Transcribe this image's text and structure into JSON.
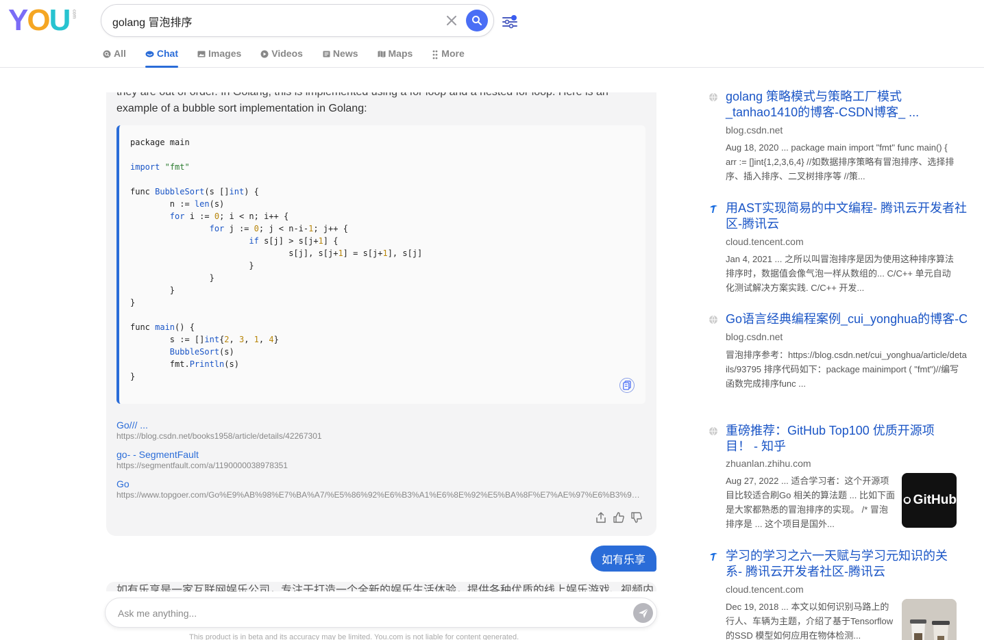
{
  "logo": {
    "text": "YOU",
    "sub": "com"
  },
  "search": {
    "query": "golang 冒泡排序",
    "placeholder": ""
  },
  "tabs": [
    {
      "label": "All",
      "icon": "search-icon"
    },
    {
      "label": "Chat",
      "icon": "chat-icon",
      "active": true
    },
    {
      "label": "Images",
      "icon": "image-icon"
    },
    {
      "label": "Videos",
      "icon": "play-icon"
    },
    {
      "label": "News",
      "icon": "newspaper-icon"
    },
    {
      "label": "Maps",
      "icon": "map-icon"
    },
    {
      "label": "More",
      "icon": "more-icon"
    }
  ],
  "chat": {
    "intro_cut": "they are out of order. In Golang, this is implemented using a for loop and a nested for loop. Here is an",
    "intro": "example of a bubble sort implementation in Golang:",
    "references": [
      {
        "title": "Go/// ...",
        "url": "https://blog.csdn.net/books1958/article/details/42267301"
      },
      {
        "title": "go- - SegmentFault",
        "url": "https://segmentfault.com/a/1190000038978351"
      },
      {
        "title": "Go",
        "url": "https://www.topgoer.com/Go%E9%AB%98%E7%BA%A7/%E5%86%92%E6%B3%A1%E6%8E%92%E5%BA%8F%E7%AE%97%E6%B3%95...."
      }
    ],
    "user_message": "如有乐享",
    "next_reply_cut": "如有乐享是一家互联网娱乐公司，专注于打造一个全新的娱乐生活体验，提供各种优质的线上娱乐游戏、视频内",
    "ask_placeholder": "Ask me anything...",
    "disclaimer": "This product is in beta and its accuracy may be limited. You.com is not liable for content generated."
  },
  "results": [
    {
      "title": "golang 策略模式与策略工厂模式_tanhao1410的博客-CSDN博客_ ...",
      "domain": "blog.csdn.net",
      "snippet": "Aug 18, 2020 ... package main import \"fmt\" func main() { arr := []int{1,2,3,6,4} //如数据排序策略有冒泡排序、选择排序、插入排序、二叉树排序等 //策...",
      "icon": "globe-icon"
    },
    {
      "title": "用AST实现简易的中文编程- 腾讯云开发者社区-腾讯云",
      "domain": "cloud.tencent.com",
      "snippet": "Jan 4, 2021 ... 之所以叫冒泡排序是因为使用这种排序算法排序时，数据值会像气泡一样从数组的... C/C++ 单元自动化测试解决方案实践. C/C++ 开发...",
      "icon": "tencent-icon"
    },
    {
      "title": "Go语言经典编程案例_cui_yonghua的博客-CSDN博客",
      "domain": "blog.csdn.net",
      "snippet": "冒泡排序参考：https://blog.csdn.net/cui_yonghua/article/details/93795 排序代码如下：package mainimport ( \"fmt\")//编写函数完成排序func ...",
      "icon": "globe-icon"
    },
    {
      "title": "重磅推荐：GitHub Top100 优质开源项目！ - 知乎",
      "domain": "zhuanlan.zhihu.com",
      "snippet": "Aug 27, 2022 ... 适合学习者：这个开源项目比较适合刷Go 相关的算法题 ... 比如下面是大家都熟悉的冒泡排序的实现。 /* 冒泡排序是 ... 这个项目是国外...",
      "icon": "globe-icon",
      "thumb_text": "GitHub"
    },
    {
      "title": "学习的学习之六一天赋与学习元知识的关系- 腾讯云开发者社区-腾讯云",
      "domain": "cloud.tencent.com",
      "snippet": "Dec 19, 2018 ... 本文以如何识别马路上的行人、车辆为主题，介绍了基于Tensorflow 的SSD 模型如何应用在物体检测...",
      "icon": "tencent-icon"
    }
  ],
  "colors": {
    "accent": "#2a6cd8",
    "search_button": "#4a6ef5"
  }
}
